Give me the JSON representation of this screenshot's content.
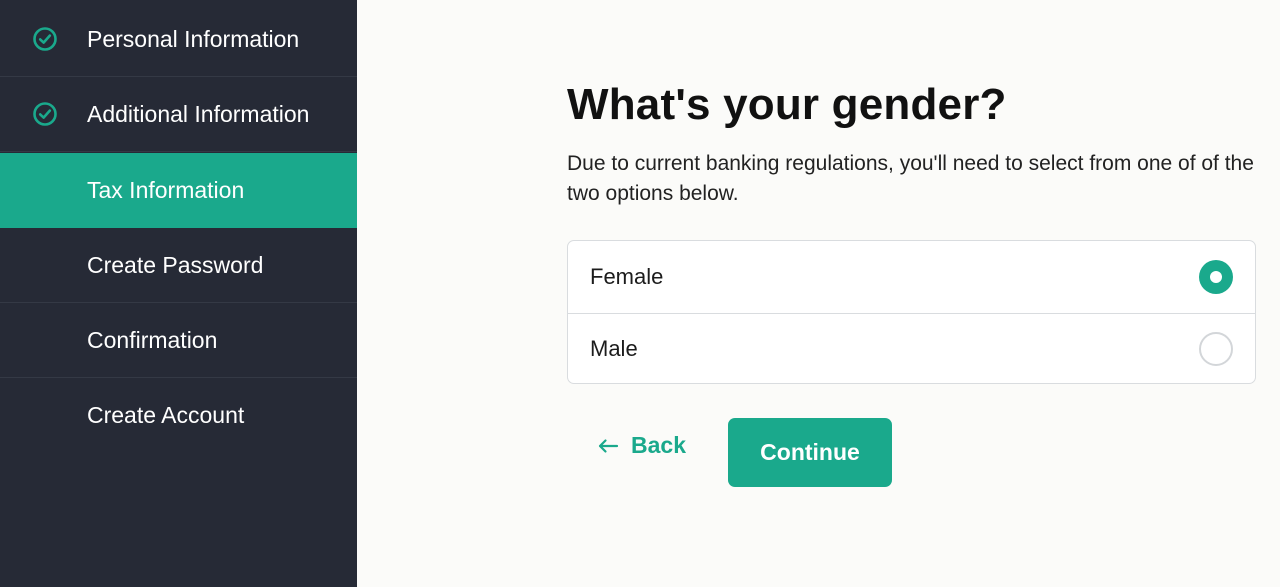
{
  "sidebar": {
    "steps": [
      {
        "label": "Personal Information",
        "status": "completed",
        "icon": "check-circle-icon"
      },
      {
        "label": "Additional Information",
        "status": "completed",
        "icon": "check-circle-icon"
      },
      {
        "label": "Tax Information",
        "status": "active"
      },
      {
        "label": "Create Password",
        "status": "pending"
      },
      {
        "label": "Confirmation",
        "status": "pending"
      },
      {
        "label": "Create Account",
        "status": "pending"
      }
    ]
  },
  "main": {
    "title": "What's your gender?",
    "description": "Due to current banking regulations, you'll need to select from one of of the two options below.",
    "options": [
      {
        "label": "Female",
        "selected": true
      },
      {
        "label": "Male",
        "selected": false
      }
    ],
    "back_label": "Back",
    "back_icon": "arrow-left-icon",
    "continue_label": "Continue"
  },
  "colors": {
    "accent": "#1aa98c",
    "sidebar_bg": "#262a36",
    "page_bg": "#fbfbf9",
    "text": "#111111"
  }
}
